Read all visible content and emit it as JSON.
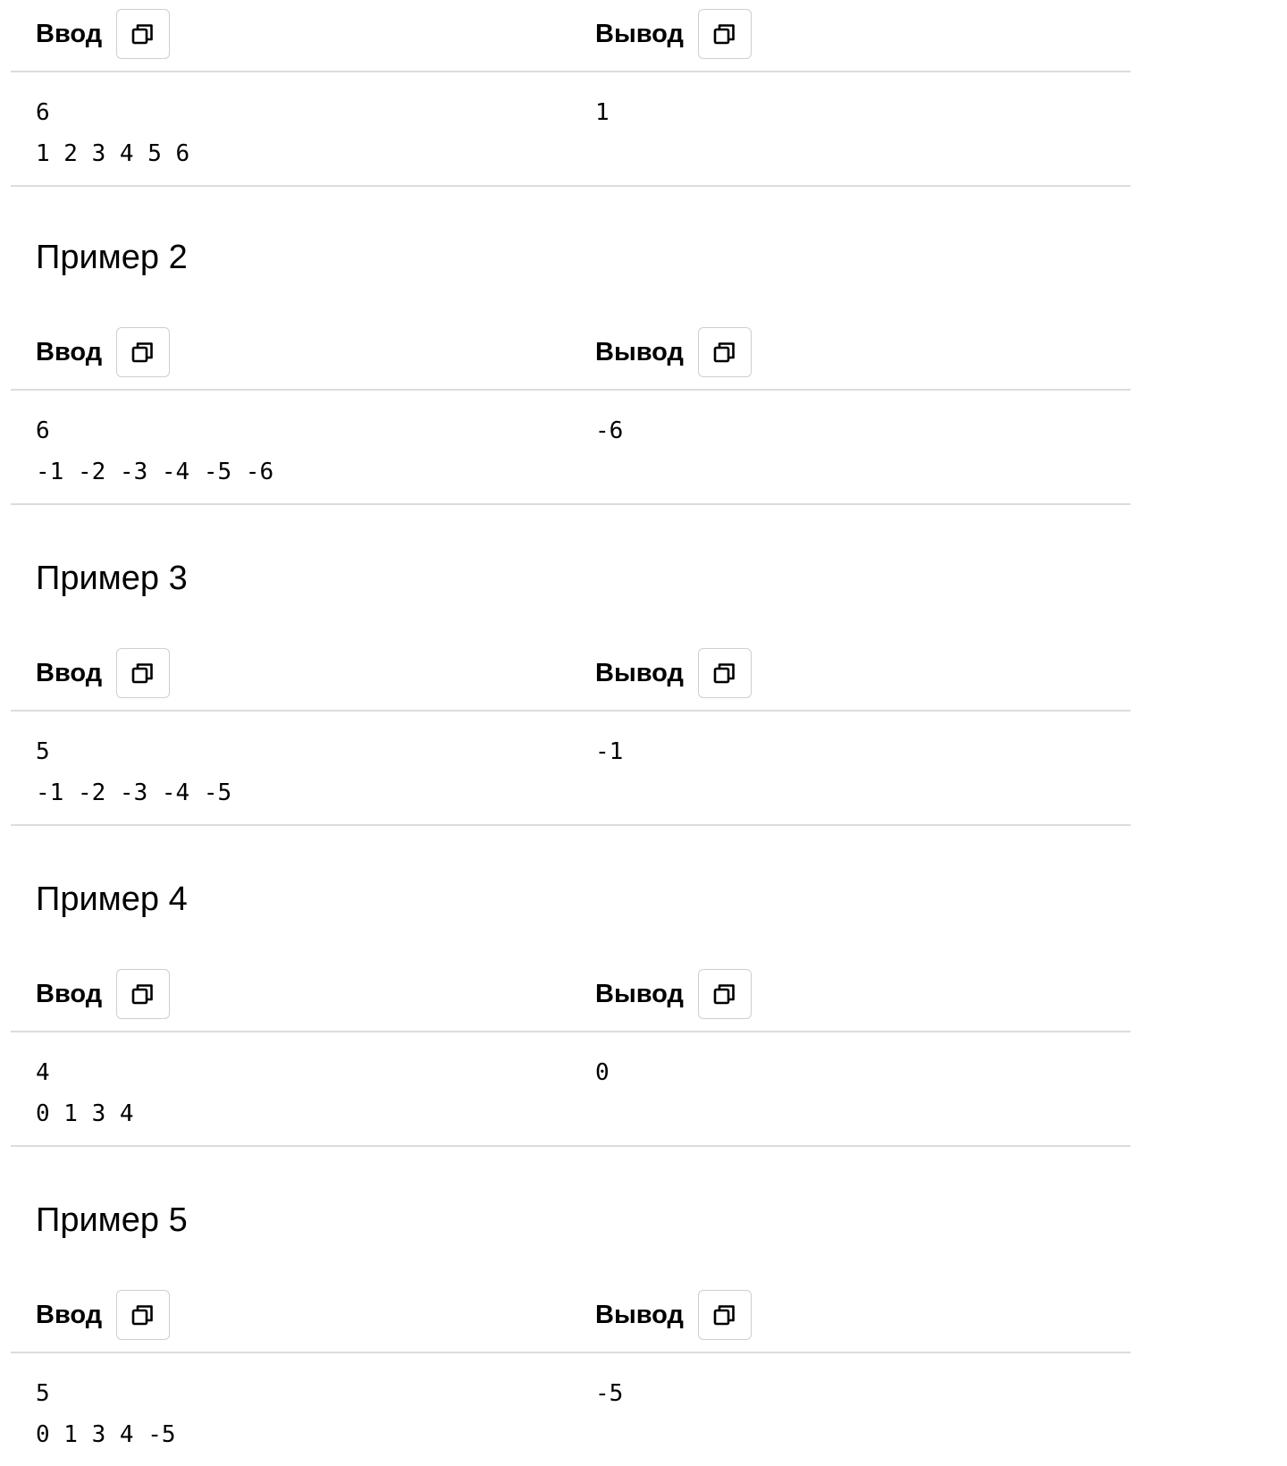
{
  "labels": {
    "input": "Ввод",
    "output": "Вывод"
  },
  "examples": [
    {
      "title": "",
      "input_lines": [
        "6",
        "1 2 3 4 5 6"
      ],
      "output_lines": [
        "1"
      ]
    },
    {
      "title": "Пример 2",
      "input_lines": [
        "6",
        "-1 -2 -3 -4 -5 -6"
      ],
      "output_lines": [
        "-6"
      ]
    },
    {
      "title": "Пример 3",
      "input_lines": [
        "5",
        "-1 -2 -3 -4 -5"
      ],
      "output_lines": [
        "-1"
      ]
    },
    {
      "title": "Пример 4",
      "input_lines": [
        "4",
        "0 1 3 4"
      ],
      "output_lines": [
        "0"
      ]
    },
    {
      "title": "Пример 5",
      "input_lines": [
        "5",
        "0 1 3 4 -5"
      ],
      "output_lines": [
        "-5"
      ]
    }
  ],
  "icons": {
    "copy": "copy-icon"
  }
}
